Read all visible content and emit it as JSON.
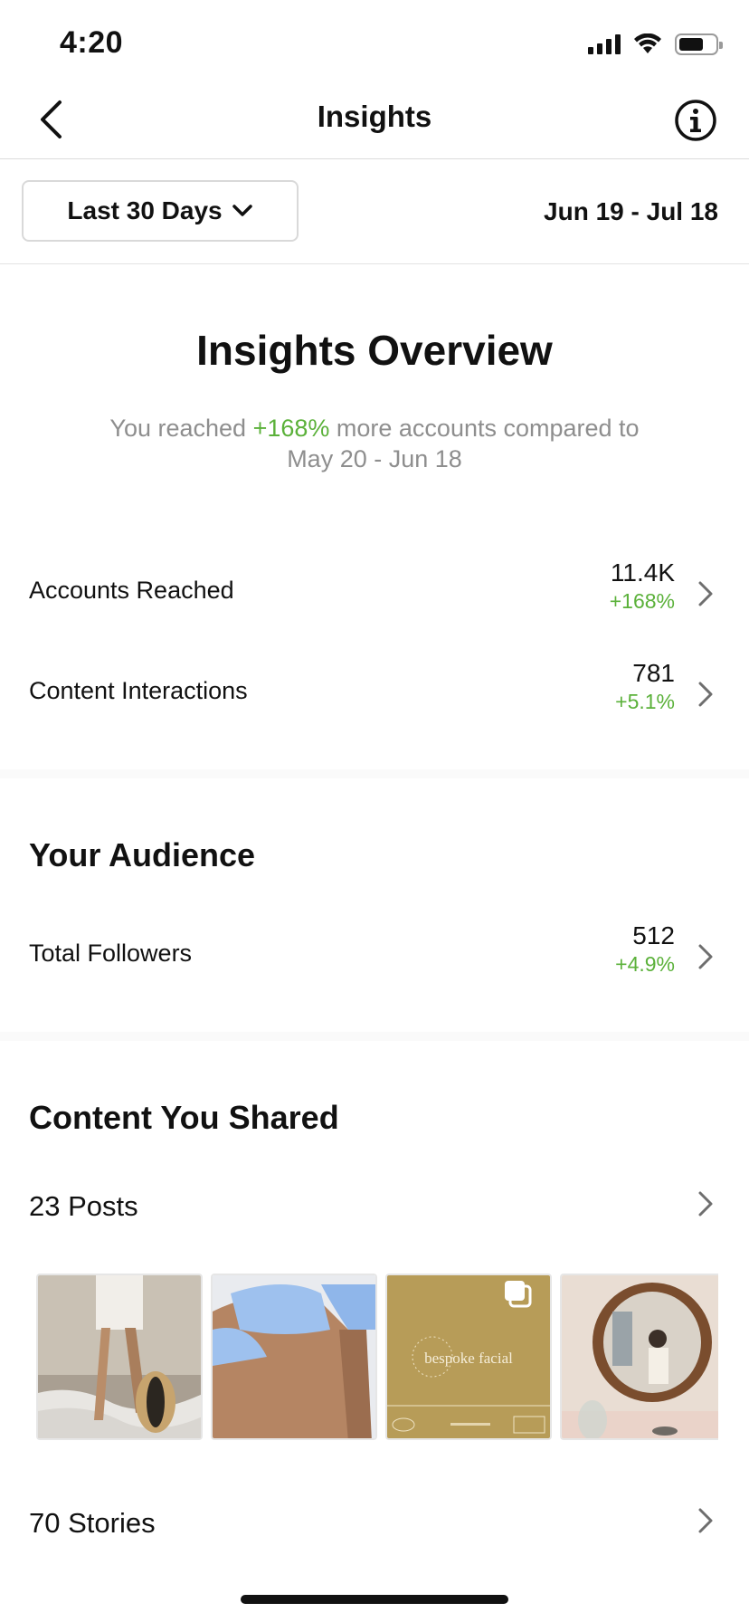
{
  "status_bar": {
    "time": "4:20"
  },
  "header": {
    "title": "Insights"
  },
  "filter": {
    "range_label": "Last 30 Days",
    "date_range": "Jun 19 - Jul 18"
  },
  "overview": {
    "title": "Insights Overview",
    "subtitle_prefix": "You reached ",
    "subtitle_highlight": "+168%",
    "subtitle_suffix": " more accounts compared to",
    "subtitle_line2": "May 20 - Jun 18",
    "metrics": [
      {
        "label": "Accounts Reached",
        "value": "11.4K",
        "change": "+168%"
      },
      {
        "label": "Content Interactions",
        "value": "781",
        "change": "+5.1%"
      }
    ]
  },
  "audience": {
    "title": "Your Audience",
    "metrics": [
      {
        "label": "Total Followers",
        "value": "512",
        "change": "+4.9%"
      }
    ]
  },
  "content": {
    "title": "Content You Shared",
    "posts_label": "23 Posts",
    "stories_label": "70 Stories",
    "thumbnail_text": "bespoke facial"
  },
  "colors": {
    "positive": "#5bb13a",
    "muted": "#8e8e8e"
  }
}
